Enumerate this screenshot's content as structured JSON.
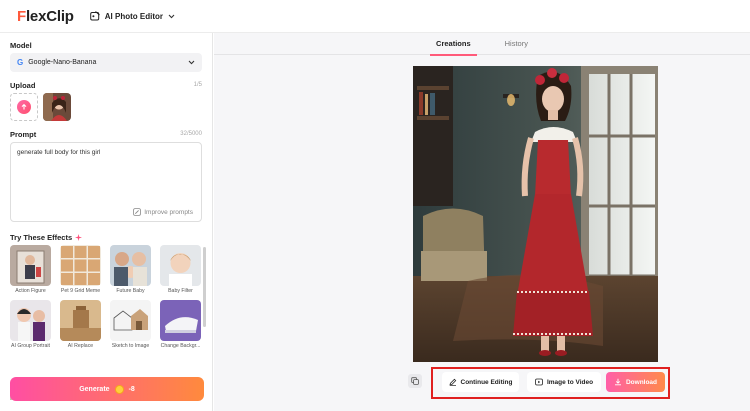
{
  "header": {
    "logo_prefix": "F",
    "logo_rest": "lexClip",
    "editor_label": "AI Photo Editor"
  },
  "sidebar": {
    "model_label": "Model",
    "model_value": "Google-Nano-Banana",
    "upload_label": "Upload",
    "upload_count": "1/5",
    "prompt_label": "Prompt",
    "prompt_count": "32/5000",
    "prompt_text": "generate full body for this girl",
    "improve_label": "Improve prompts",
    "effects_label": "Try These Effects",
    "effects": [
      {
        "label": "Action Figure"
      },
      {
        "label": "Pet 9 Grid Meme"
      },
      {
        "label": "Future Baby"
      },
      {
        "label": "Baby Filter"
      },
      {
        "label": "AI Group Portrait"
      },
      {
        "label": "AI Replace"
      },
      {
        "label": "Sketch to Image"
      },
      {
        "label": "Change Backgr..."
      }
    ],
    "generate_label": "Generate",
    "generate_cost": "-8"
  },
  "main": {
    "tabs": [
      {
        "label": "Creations",
        "active": true
      },
      {
        "label": "History",
        "active": false
      }
    ],
    "actions": {
      "continue_label": "Continue Editing",
      "video_label": "Image to Video",
      "download_label": "Download"
    }
  },
  "colors": {
    "brand": "#ff5a3c",
    "accent_gradient_start": "#ff4ea3",
    "accent_gradient_end": "#ff8a3d",
    "highlight_box": "#e02020"
  }
}
